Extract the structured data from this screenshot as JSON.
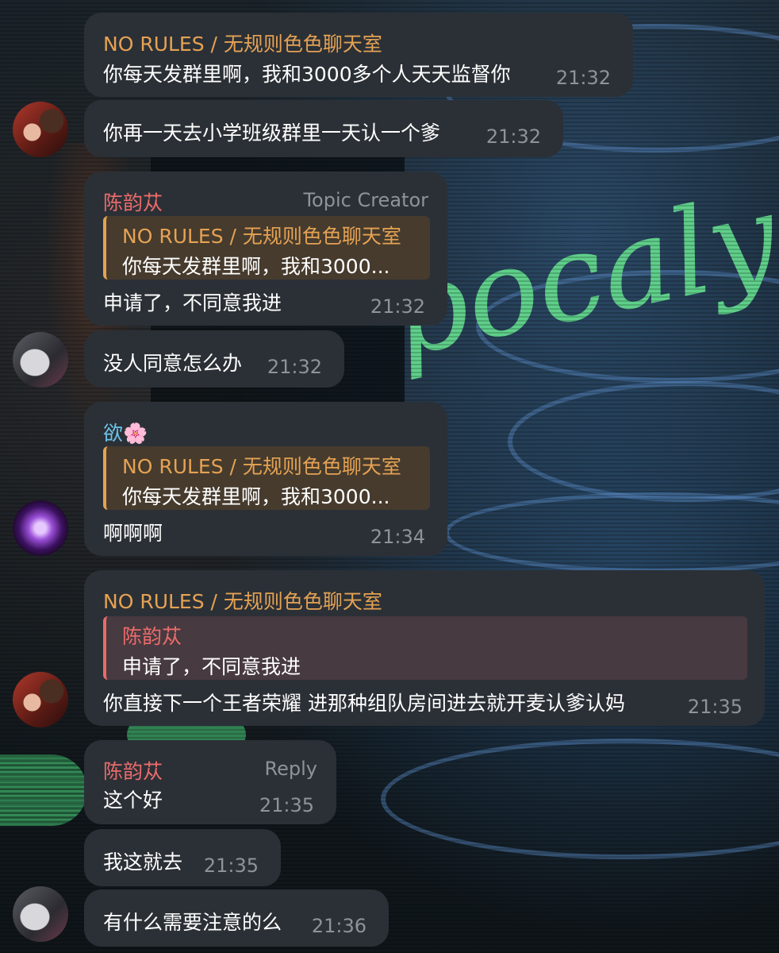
{
  "messages": [
    {
      "sender": "NO RULES / 无规则色色聊天室",
      "text": "你每天发群里啊，我和3000多个人天天监督你",
      "time": "21:32"
    },
    {
      "text": "你再一天去小学班级群里一天认一个爹",
      "time": "21:32",
      "avatar": "avatar-red-hair"
    },
    {
      "sender": "陈韵苁",
      "tag": "Topic Creator",
      "quote": {
        "name": "NO RULES / 无规则色色聊天室",
        "text": "你每天发群里啊，我和3000..."
      },
      "text": "申请了，不同意我进",
      "time": "21:32"
    },
    {
      "text": "没人同意怎么办",
      "time": "21:32",
      "avatar": "avatar-gray"
    },
    {
      "sender": "欲🌸",
      "quote": {
        "name": "NO RULES / 无规则色色聊天室",
        "text": "你每天发群里啊，我和3000..."
      },
      "text": "啊啊啊",
      "time": "21:34",
      "avatar": "avatar-purple"
    },
    {
      "sender": "NO RULES / 无规则色色聊天室",
      "quote": {
        "name": "陈韵苁",
        "text": "申请了，不同意我进"
      },
      "text": "你直接下一个王者荣耀 进那种组队房间进去就开麦认爹认妈",
      "time": "21:35",
      "avatar": "avatar-red-hair"
    },
    {
      "sender": "陈韵苁",
      "tag": "Reply",
      "text": "这个好",
      "time": "21:35"
    },
    {
      "text": "我这就去",
      "time": "21:35"
    },
    {
      "text": "有什么需要注意的么",
      "time": "21:36",
      "avatar": "avatar-gray"
    }
  ],
  "wallpaper": {
    "script_text": "pocalyp"
  },
  "colors": {
    "bubble": "#2b3036",
    "sender_orange": "#e5a253",
    "sender_red": "#e96b6b",
    "sender_blue": "#6cc4e8",
    "time": "#8d9399"
  }
}
